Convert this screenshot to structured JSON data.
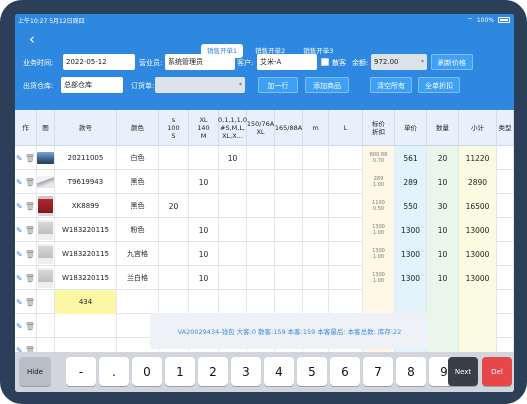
{
  "status": {
    "time": "上午10:27",
    "date": "5月12日周四",
    "battery": "100%"
  },
  "tabs": [
    {
      "label": "销售开单1",
      "active": true
    },
    {
      "label": "销售开单2",
      "active": false
    },
    {
      "label": "销售开单3",
      "active": false
    }
  ],
  "form": {
    "business_time_label": "业务时间:",
    "business_time_value": "2022-05-12",
    "salesperson_label": "营业员:",
    "salesperson_value": "系统管理员",
    "customer_label": "客户:",
    "customer_value": "艾米-A",
    "walkin_label": "散客",
    "balance_label": "余额:",
    "balance_value": "972.00",
    "refresh_price_button": "刷新价格",
    "warehouse_label": "出货仓库:",
    "warehouse_value": "总部仓库",
    "order_label": "订货单:",
    "order_value": "",
    "add_row_button": "加一行",
    "add_product_button": "添加商品",
    "clear_all_button": "清空所有",
    "full_discount_button": "全单折扣"
  },
  "table": {
    "headers": [
      "作",
      "图",
      "款号",
      "颜色",
      "s\n100\nS",
      "XL\n140\nM",
      "0,1,1,1,0\n#S,M,L,\nXL,X...",
      "150/76A\nXL",
      "165/88A",
      "m",
      "L",
      "标价\n折扣",
      "单价",
      "数量",
      "小计",
      "类型"
    ],
    "rows": [
      {
        "code": "20211005",
        "color": "白色",
        "sizes": [
          "",
          "",
          "10",
          "",
          "",
          "",
          ""
        ],
        "tag_price": "800.88",
        "discount": "0.70",
        "unit_price": "561",
        "qty": "20",
        "subtotal": "11220",
        "image": "scenery"
      },
      {
        "code": "T9619943",
        "color": "黑色",
        "sizes": [
          "",
          "10",
          "",
          "",
          "",
          "",
          ""
        ],
        "tag_price": "289",
        "discount": "1.00",
        "unit_price": "289",
        "qty": "10",
        "subtotal": "2890",
        "image": "mountain"
      },
      {
        "code": "XK8899",
        "color": "黑色",
        "sizes": [
          "20",
          "",
          "",
          "",
          "",
          "",
          ""
        ],
        "tag_price": "1100",
        "discount": "0.50",
        "unit_price": "550",
        "qty": "30",
        "subtotal": "16500",
        "image": "red-coat"
      },
      {
        "code": "W183220115",
        "color": "粉色",
        "sizes": [
          "",
          "10",
          "",
          "",
          "",
          "",
          ""
        ],
        "tag_price": "1300",
        "discount": "1.00",
        "unit_price": "1300",
        "qty": "10",
        "subtotal": "13000",
        "image": "suit"
      },
      {
        "code": "W183220115",
        "color": "九宫格",
        "sizes": [
          "",
          "10",
          "",
          "",
          "",
          "",
          ""
        ],
        "tag_price": "1300",
        "discount": "1.00",
        "unit_price": "1300",
        "qty": "10",
        "subtotal": "13000",
        "image": "suit"
      },
      {
        "code": "W183220115",
        "color": "兰白格",
        "sizes": [
          "",
          "10",
          "",
          "",
          "",
          "",
          ""
        ],
        "tag_price": "1300",
        "discount": "1.00",
        "unit_price": "1300",
        "qty": "10",
        "subtotal": "13000",
        "image": "suit"
      }
    ],
    "total_row": {
      "code_total": "434"
    }
  },
  "toast": {
    "text": "VA20029434-钱包 大客:0    散客:159  本客:159 本客最后: 本客总数: 库存:22"
  },
  "keypad": {
    "hide": "Hide",
    "keys": [
      "-",
      ".",
      "0",
      "1",
      "2",
      "3",
      "4",
      "5",
      "6",
      "7",
      "8",
      "9"
    ],
    "next": "Next",
    "del": "Del"
  },
  "colors": {
    "primary": "#2f88e0",
    "button": "#3ea0f5",
    "del_key": "#e8474a",
    "next_key": "#3a3f47",
    "device_frame": "#2b4058"
  }
}
